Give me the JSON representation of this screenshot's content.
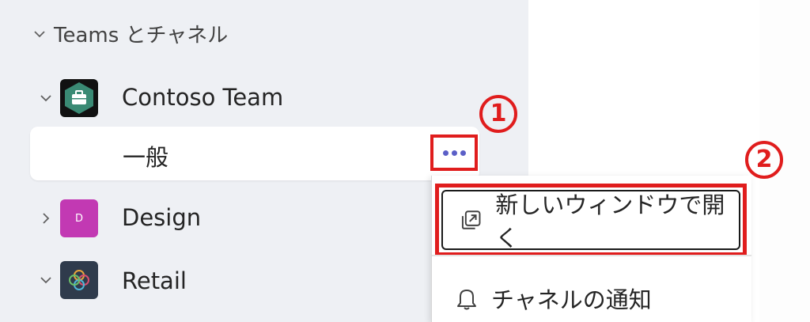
{
  "sidebar": {
    "section_title": "Teams とチャネル",
    "teams": [
      {
        "name": "Contoso Team",
        "expanded": true,
        "avatar_color": "#3a8a74"
      },
      {
        "name": "Design",
        "expanded": false,
        "avatar_letter": "D",
        "avatar_color": "#c239b3"
      },
      {
        "name": "Retail",
        "expanded": true,
        "avatar_color": "#2f3b4c"
      }
    ],
    "channels": [
      {
        "name": "一般"
      }
    ]
  },
  "callouts": {
    "first": "1",
    "second": "2"
  },
  "context_menu": {
    "open_new_window": "新しいウィンドウで開く",
    "channel_notifications": "チャネルの通知"
  },
  "colors": {
    "highlight": "#e01d1d",
    "accent": "#5b5fc7"
  }
}
